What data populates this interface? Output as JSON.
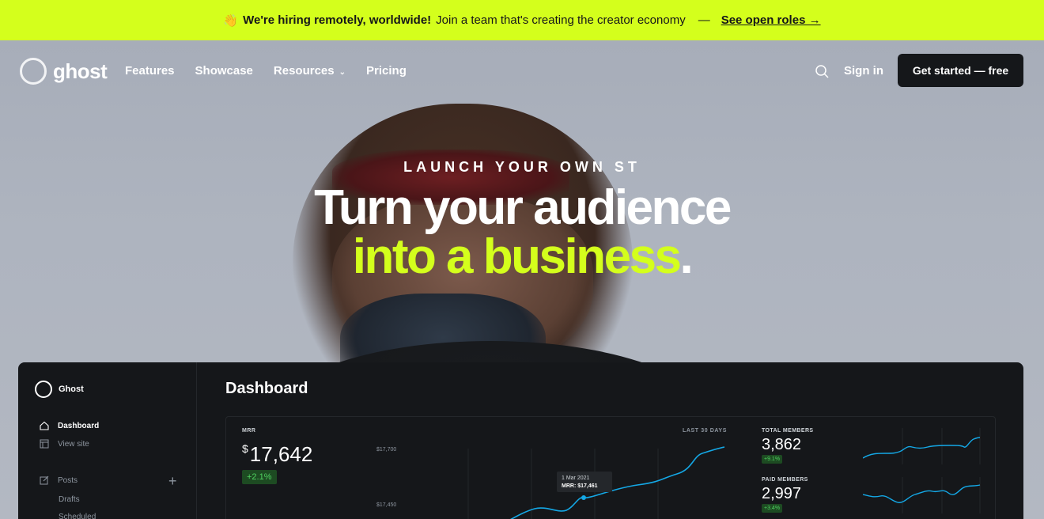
{
  "announcement": {
    "emoji": "👋",
    "bold": "We're hiring remotely, worldwide!",
    "text": "Join a team that's creating the creator economy",
    "separator": "—",
    "link": "See open roles →"
  },
  "nav": {
    "brand": "ghost",
    "items": [
      {
        "label": "Features"
      },
      {
        "label": "Showcase"
      },
      {
        "label": "Resources",
        "has_dropdown": true
      },
      {
        "label": "Pricing"
      }
    ],
    "signin": "Sign in",
    "cta": "Get started — free",
    "icons": {
      "search": "search-icon",
      "dropdown": "chevron-down-icon"
    }
  },
  "hero": {
    "eyebrow": "LAUNCH YOUR OWN ST",
    "line1": "Turn your audience",
    "line2_accent": "into a business",
    "line2_end": ".",
    "accent_color": "#d4ff1c"
  },
  "dashboard": {
    "brand": "Ghost",
    "title": "Dashboard",
    "sidebar": [
      {
        "label": "Dashboard",
        "icon": "home-icon",
        "active": true
      },
      {
        "label": "View site",
        "icon": "layout-icon",
        "active": false
      },
      {
        "label": "Posts",
        "icon": "edit-icon",
        "active": false
      }
    ],
    "sub_items": [
      "Drafts",
      "Scheduled"
    ],
    "mrr": {
      "label": "MRR",
      "currency": "$",
      "value": "17,642",
      "delta": "+2.1%",
      "period": "LAST 30 DAYS",
      "ticks": [
        "$17,700",
        "$17,450"
      ],
      "tooltip_date": "1 Mar 2021",
      "tooltip_value": "MRR: $17,461"
    },
    "stats": [
      {
        "label": "TOTAL MEMBERS",
        "value": "3,862",
        "delta": "+9.1%"
      },
      {
        "label": "PAID MEMBERS",
        "value": "2,997",
        "delta": "+3.4%"
      }
    ]
  }
}
